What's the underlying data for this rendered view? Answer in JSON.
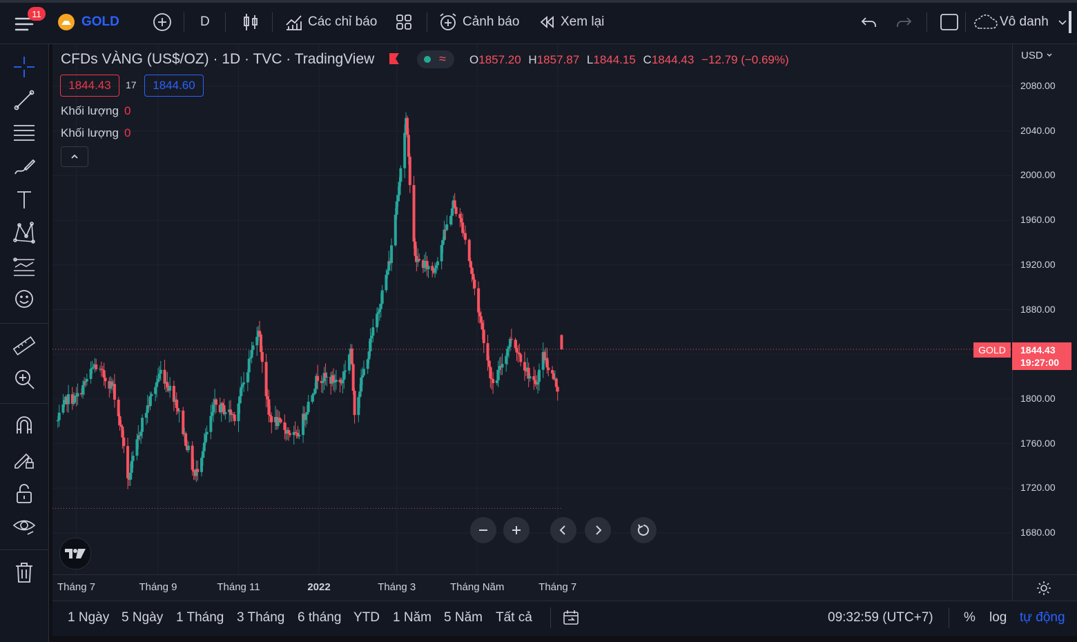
{
  "header": {
    "notifications_count": "11",
    "symbol": "GOLD",
    "interval": "D",
    "indicators_label": "Các chỉ báo",
    "alerts_label": "Cảnh báo",
    "replay_label": "Xem lại",
    "layout_name": "Vô danh"
  },
  "legend": {
    "title": "CFDs VÀNG (US$/OZ) · 1D · TVC · TradingView",
    "o_label": "O",
    "o_value": "1857.20",
    "h_label": "H",
    "h_value": "1857.87",
    "l_label": "L",
    "l_value": "1844.15",
    "c_label": "C",
    "c_value": "1844.43",
    "change": "−12.79 (−0.69%)",
    "bid": "1844.43",
    "spread": "17",
    "ask": "1844.60",
    "volume_label_1": "Khối lượng",
    "volume_value_1": "0",
    "volume_label_2": "Khối lượng",
    "volume_value_2": "0"
  },
  "price_axis": {
    "currency": "USD",
    "ticks": [
      "2080.00",
      "2040.00",
      "2000.00",
      "1960.00",
      "1920.00",
      "1880.00",
      "1840.00",
      "1800.00",
      "1760.00",
      "1720.00",
      "1680.00"
    ],
    "last_symbol": "GOLD",
    "last_price": "1844.43",
    "countdown": "19:27:00"
  },
  "time_axis": {
    "ticks": [
      "Tháng 7",
      "Tháng 9",
      "Tháng 11",
      "2022",
      "Tháng 3",
      "Tháng Năm",
      "Tháng 7"
    ]
  },
  "bottom_bar": {
    "ranges": [
      "1 Ngày",
      "5 Ngày",
      "1 Tháng",
      "3 Tháng",
      "6 tháng",
      "YTD",
      "1 Năm",
      "5 Năm",
      "Tất cả"
    ],
    "clock": "09:32:59 (UTC+7)",
    "percent": "%",
    "log": "log",
    "auto": "tự động"
  },
  "colors": {
    "up": "#26a69a",
    "down": "#f7525f",
    "background": "#161a25",
    "accent": "#2962ff"
  },
  "chart_data": {
    "type": "candlestick",
    "symbol": "GOLD",
    "interval": "1D",
    "ylim": [
      1670,
      2090
    ],
    "anchors": [
      [
        "2021-06-17",
        1780
      ],
      [
        "2021-06-24",
        1800
      ],
      [
        "2021-07-01",
        1800
      ],
      [
        "2021-07-15",
        1830
      ],
      [
        "2021-07-29",
        1810
      ],
      [
        "2021-08-06",
        1760
      ],
      [
        "2021-08-09",
        1725
      ],
      [
        "2021-08-20",
        1780
      ],
      [
        "2021-09-03",
        1825
      ],
      [
        "2021-09-14",
        1800
      ],
      [
        "2021-09-29",
        1730
      ],
      [
        "2021-10-14",
        1795
      ],
      [
        "2021-10-29",
        1785
      ],
      [
        "2021-11-05",
        1815
      ],
      [
        "2021-11-16",
        1865
      ],
      [
        "2021-11-24",
        1785
      ],
      [
        "2021-12-15",
        1765
      ],
      [
        "2021-12-31",
        1820
      ],
      [
        "2022-01-18",
        1815
      ],
      [
        "2022-01-25",
        1845
      ],
      [
        "2022-01-28",
        1790
      ],
      [
        "2022-02-11",
        1860
      ],
      [
        "2022-02-24",
        1925
      ],
      [
        "2022-03-08",
        2050
      ],
      [
        "2022-03-15",
        1925
      ],
      [
        "2022-03-29",
        1915
      ],
      [
        "2022-04-13",
        1975
      ],
      [
        "2022-04-21",
        1950
      ],
      [
        "2022-05-13",
        1810
      ],
      [
        "2022-05-27",
        1855
      ],
      [
        "2022-06-14",
        1810
      ],
      [
        "2022-06-20",
        1840
      ],
      [
        "2022-07-01",
        1810
      ],
      [
        "2022-07-04",
        1844.43
      ]
    ],
    "last": {
      "date": "2022-07-04",
      "open": 1857.2,
      "high": 1857.87,
      "low": 1844.15,
      "close": 1844.43
    }
  }
}
